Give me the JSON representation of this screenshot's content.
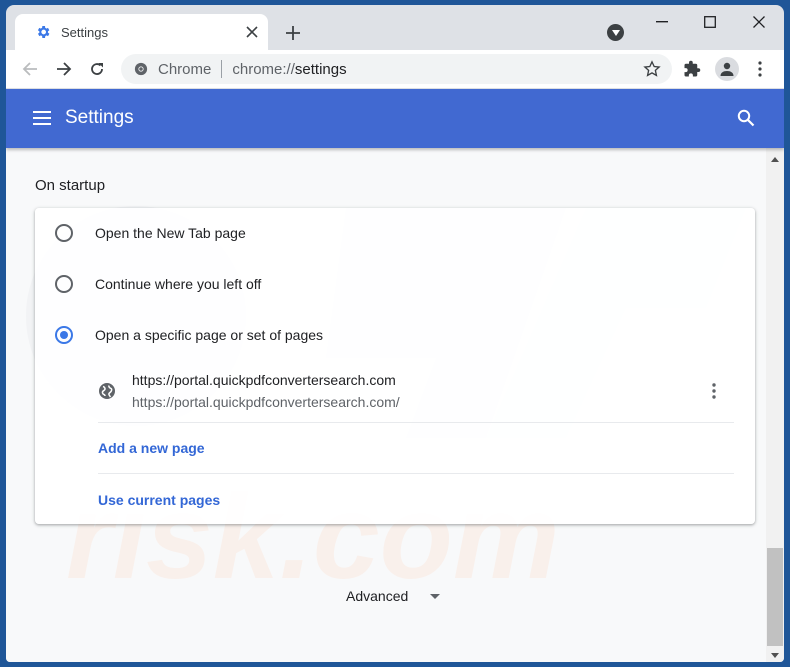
{
  "browser": {
    "tab": {
      "title": "Settings",
      "favicon": "gear-icon",
      "close": "close-icon"
    },
    "new_tab": "plus-icon",
    "tab_search": "tab-search-icon",
    "window_controls": {
      "minimize": "minimize-icon",
      "maximize": "maximize-icon",
      "close": "close-icon"
    },
    "nav": {
      "back": "arrow-left-icon",
      "forward": "arrow-right-icon",
      "reload": "reload-icon"
    },
    "omnibox": {
      "chip_label": "Chrome",
      "url_scheme": "chrome://",
      "url_path": "settings"
    },
    "toolbar_icons": [
      "star-icon",
      "extensions-icon",
      "profile-icon",
      "more-vert-icon"
    ]
  },
  "settings_header": {
    "title": "Settings",
    "menu_icon": "hamburger-menu-icon",
    "search_icon": "search-icon"
  },
  "on_startup": {
    "section_title": "On startup",
    "options": [
      {
        "label": "Open the New Tab page",
        "checked": false
      },
      {
        "label": "Continue where you left off",
        "checked": false
      },
      {
        "label": "Open a specific page or set of pages",
        "checked": true
      }
    ],
    "pages": [
      {
        "title": "https://portal.quickpdfconvertersearch.com",
        "url": "https://portal.quickpdfconvertersearch.com/"
      }
    ],
    "add_page_label": "Add a new page",
    "use_current_label": "Use current pages"
  },
  "advanced": {
    "label": "Advanced"
  },
  "colors": {
    "header_blue": "#4169d1",
    "link_blue": "#3367d6",
    "radio_checked": "#3b78e7",
    "frame_blue": "#1f5698"
  }
}
